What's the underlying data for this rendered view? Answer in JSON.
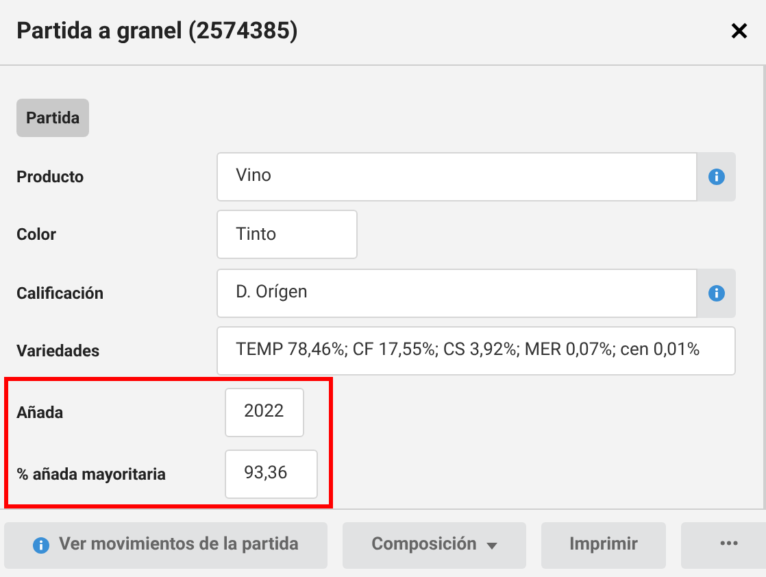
{
  "window": {
    "title": "Partida a granel (2574385)",
    "close": "✕"
  },
  "section": {
    "label": "Partida"
  },
  "fields": [
    {
      "label": "Producto",
      "value": "Vino",
      "info": true,
      "highlighted": false
    },
    {
      "label": "Color",
      "value": "Tinto",
      "info": false,
      "highlighted": false
    },
    {
      "label": "Calificación",
      "value": "D. Orígen",
      "info": true,
      "highlighted": false
    },
    {
      "label": "Variedades",
      "value": "TEMP 78,46%; CF 17,55%; CS 3,92%; MER 0,07%; cen 0,01%",
      "info": false,
      "highlighted": false
    },
    {
      "label": "Añada",
      "value": "2022",
      "info": false,
      "highlighted": true
    },
    {
      "label": "% añada mayoritaria",
      "value": "93,36",
      "info": false,
      "highlighted": true
    }
  ],
  "buttons": [
    {
      "label": "Ver movimientos de la partida",
      "kind": "info"
    },
    {
      "label": "Composición",
      "kind": "dropdown"
    },
    {
      "label": "Imprimir",
      "kind": "plain"
    },
    {
      "label": "•••",
      "kind": "more"
    }
  ]
}
